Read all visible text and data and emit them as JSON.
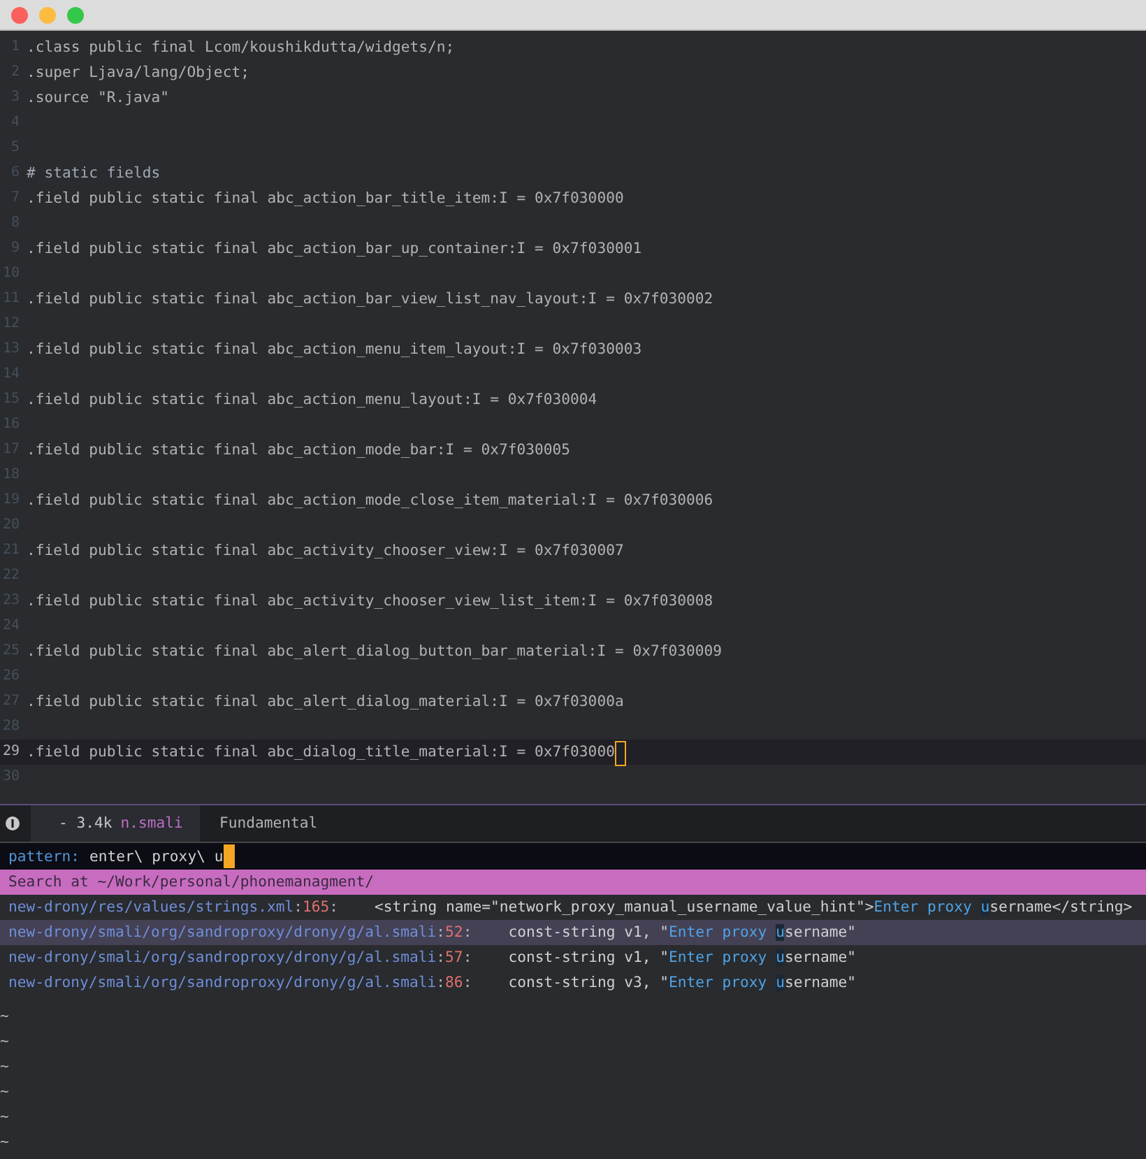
{
  "editor": {
    "lines": [
      {
        "number": "1",
        "text": ".class public final Lcom/koushikdutta/widgets/n;",
        "kind": "code",
        "current": false
      },
      {
        "number": "2",
        "text": ".super Ljava/lang/Object;",
        "kind": "code",
        "current": false
      },
      {
        "number": "3",
        "text": ".source \"R.java\"",
        "kind": "code",
        "current": false
      },
      {
        "number": "4",
        "current": false
      },
      {
        "number": "5",
        "current": false
      },
      {
        "number": "6",
        "text": "# static fields",
        "kind": "comment",
        "current": false
      },
      {
        "number": "7",
        "text": ".field public static final abc_action_bar_title_item:I = 0x7f030000",
        "kind": "code",
        "current": false
      },
      {
        "number": "8",
        "current": false
      },
      {
        "number": "9",
        "text": ".field public static final abc_action_bar_up_container:I = 0x7f030001",
        "kind": "code",
        "current": false
      },
      {
        "number": "10",
        "current": false
      },
      {
        "number": "11",
        "text": ".field public static final abc_action_bar_view_list_nav_layout:I = 0x7f030002",
        "kind": "code",
        "current": false
      },
      {
        "number": "12",
        "current": false
      },
      {
        "number": "13",
        "text": ".field public static final abc_action_menu_item_layout:I = 0x7f030003",
        "kind": "code",
        "current": false
      },
      {
        "number": "14",
        "current": false
      },
      {
        "number": "15",
        "text": ".field public static final abc_action_menu_layout:I = 0x7f030004",
        "kind": "code",
        "current": false
      },
      {
        "number": "16",
        "current": false
      },
      {
        "number": "17",
        "text": ".field public static final abc_action_mode_bar:I = 0x7f030005",
        "kind": "code",
        "current": false
      },
      {
        "number": "18",
        "current": false
      },
      {
        "number": "19",
        "text": ".field public static final abc_action_mode_close_item_material:I = 0x7f030006",
        "kind": "code",
        "current": false
      },
      {
        "number": "20",
        "current": false
      },
      {
        "number": "21",
        "text": ".field public static final abc_activity_chooser_view:I = 0x7f030007",
        "kind": "code",
        "current": false
      },
      {
        "number": "22",
        "current": false
      },
      {
        "number": "23",
        "text": ".field public static final abc_activity_chooser_view_list_item:I = 0x7f030008",
        "kind": "code",
        "current": false
      },
      {
        "number": "24",
        "current": false
      },
      {
        "number": "25",
        "text": ".field public static final abc_alert_dialog_button_bar_material:I = 0x7f030009",
        "kind": "code",
        "current": false
      },
      {
        "number": "26",
        "current": false
      },
      {
        "number": "27",
        "text": ".field public static final abc_alert_dialog_material:I = 0x7f03000a",
        "kind": "code",
        "current": false
      },
      {
        "number": "28",
        "current": false
      },
      {
        "number": "29",
        "text": ".field public static final abc_dialog_title_material:I = 0x7f03000",
        "kind": "code",
        "current": true
      },
      {
        "number": "30",
        "current": false
      }
    ]
  },
  "mode_line": {
    "size": "- 3.4k",
    "file": "n.smali",
    "mode": "Fundamental"
  },
  "minibuffer": {
    "prompt": "pattern:",
    "input": "enter\\ proxy\\ u"
  },
  "search": {
    "header": "Search at ~/Work/personal/phonemanagment/",
    "results": [
      {
        "file": "new-drony/res/values/strings.xml",
        "separator": ":",
        "line": "165",
        "before": "<string name=\"network_proxy_manual_username_value_hint\">",
        "match": "Enter proxy ",
        "match_end": "u",
        "after": "sername</string>",
        "selected": false
      },
      {
        "file": "new-drony/smali/org/sandroproxy/drony/g/al.smali",
        "separator": ":",
        "line": "52",
        "before": "const-string v1, \"",
        "match": "Enter proxy ",
        "match_end": "u",
        "after": "sername\"",
        "selected": true
      },
      {
        "file": "new-drony/smali/org/sandroproxy/drony/g/al.smali",
        "separator": ":",
        "line": "57",
        "before": "const-string v1, \"",
        "match": "Enter proxy ",
        "match_end": "u",
        "after": "sername\"",
        "selected": false
      },
      {
        "file": "new-drony/smali/org/sandroproxy/drony/g/al.smali",
        "separator": ":",
        "line": "86",
        "before": "const-string v3, \"",
        "match": "Enter proxy ",
        "match_end": "u",
        "after": "sername\"",
        "selected": false
      }
    ]
  },
  "empty_lines": [
    "~",
    "~",
    "~",
    "~",
    "~",
    "~"
  ]
}
